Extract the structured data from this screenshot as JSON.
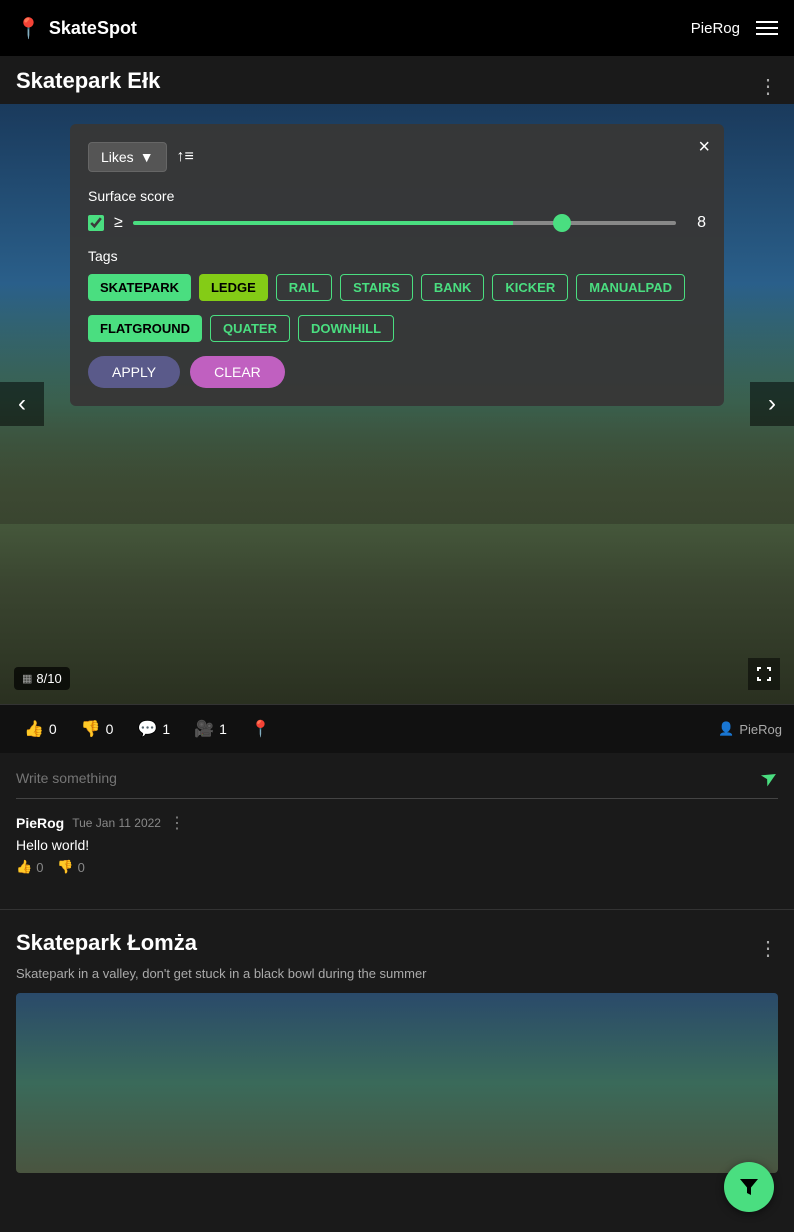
{
  "header": {
    "logo": "SkateSpot",
    "username": "PieRog",
    "hamburger_label": "menu"
  },
  "park1": {
    "title": "Skatepark Ełk",
    "more_label": "⋮",
    "score_badge": "8/10",
    "action_bar": {
      "likes": "0",
      "dislikes": "0",
      "comments": "1",
      "videos": "1",
      "author": "PieRog"
    }
  },
  "filter": {
    "close_label": "×",
    "sort": {
      "label": "Likes",
      "dropdown_arrow": "▼"
    },
    "surface_score": {
      "label": "Surface score",
      "gte": "≥",
      "value": "8",
      "slider_pct": 70
    },
    "tags": {
      "label": "Tags",
      "items": [
        {
          "id": "skatepark",
          "label": "SKATEPARK",
          "style": "active-green"
        },
        {
          "id": "ledge",
          "label": "LEDGE",
          "style": "active-lime"
        },
        {
          "id": "rail",
          "label": "RAIL",
          "style": "inactive"
        },
        {
          "id": "stairs",
          "label": "STAIRS",
          "style": "inactive"
        },
        {
          "id": "bank",
          "label": "BANK",
          "style": "inactive"
        },
        {
          "id": "kicker",
          "label": "KICKER",
          "style": "inactive"
        },
        {
          "id": "manualpad",
          "label": "MANUALPAD",
          "style": "inactive"
        },
        {
          "id": "flatground",
          "label": "FLATGROUND",
          "style": "active-green"
        },
        {
          "id": "quater",
          "label": "QUATER",
          "style": "inactive"
        },
        {
          "id": "downhill",
          "label": "DOWNHILL",
          "style": "inactive"
        }
      ]
    },
    "apply_label": "APPLY",
    "clear_label": "CLEAR"
  },
  "comment_section": {
    "placeholder": "Write something",
    "comments": [
      {
        "author": "PieRog",
        "date": "Tue Jan 11 2022",
        "text": "Hello world!",
        "likes": "0",
        "dislikes": "0"
      }
    ]
  },
  "park2": {
    "title": "Skatepark Łomża",
    "description": "Skatepark in a valley, don't get stuck in a black bowl during the summer",
    "more_label": "⋮"
  },
  "fab": {
    "label": "filter"
  }
}
